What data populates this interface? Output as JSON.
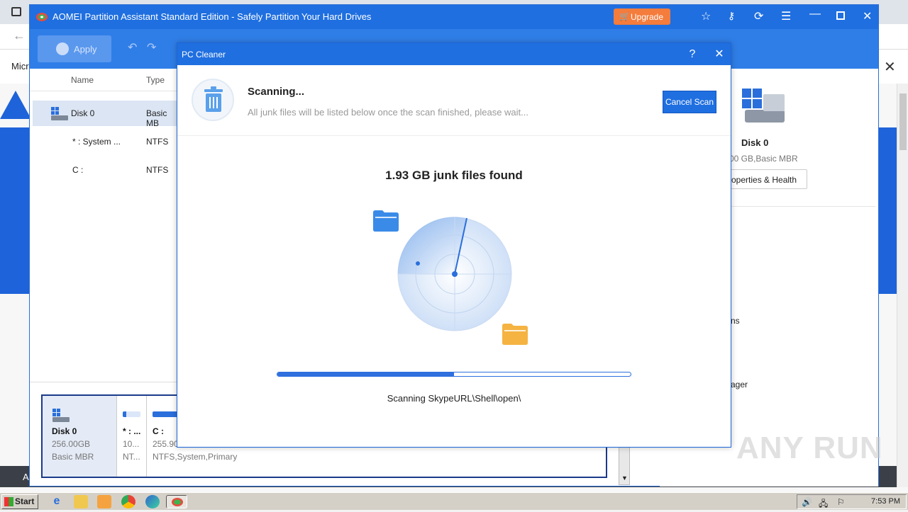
{
  "browser": {
    "partial_text_left": "Micr",
    "partial_text_bottom": "A"
  },
  "app": {
    "title": "AOMEI Partition Assistant Standard Edition - Safely Partition Your Hard Drives",
    "upgrade_label": "Upgrade",
    "apply_label": "Apply",
    "columns": {
      "name": "Name",
      "type": "Type"
    },
    "rows": [
      {
        "name": "Disk 0",
        "type": "Basic MB"
      },
      {
        "name": "* : System ...",
        "type": "NTFS"
      },
      {
        "name": "C :",
        "type": "NTFS"
      }
    ],
    "diskmap": {
      "disk_name": "Disk 0",
      "disk_size": "256.00GB",
      "disk_type": "Basic MBR",
      "part1_name": "* : ...",
      "part1_size": "10...",
      "part1_fs": "NT...",
      "part2_name": "C :",
      "part2_size": "255.90",
      "part2_fs": "NTFS,System,Primary"
    },
    "right_panel": {
      "disk_name": "Disk 0",
      "disk_info": "00 GB,Basic MBR",
      "props_label": "roperties & Health",
      "partial_1": "ns",
      "partial_2": "ager"
    }
  },
  "dialog": {
    "title": "PC Cleaner",
    "help": "?",
    "scan_title": "Scanning...",
    "scan_subtitle": "All junk files will be listed below once the scan finished, please wait...",
    "cancel_label": "Cancel Scan",
    "found_text": "1.93 GB junk files found",
    "progress": 0.5,
    "scan_path": "Scanning SkypeURL\\Shell\\open\\"
  },
  "taskbar": {
    "start_label": "Start",
    "clock": "7:53 PM"
  },
  "watermark": "ANY RUN",
  "colors": {
    "accent": "#1f6fe0",
    "upgrade": "#f47c3c",
    "folder_blue": "#3a8be8",
    "folder_orange": "#f5b342"
  }
}
